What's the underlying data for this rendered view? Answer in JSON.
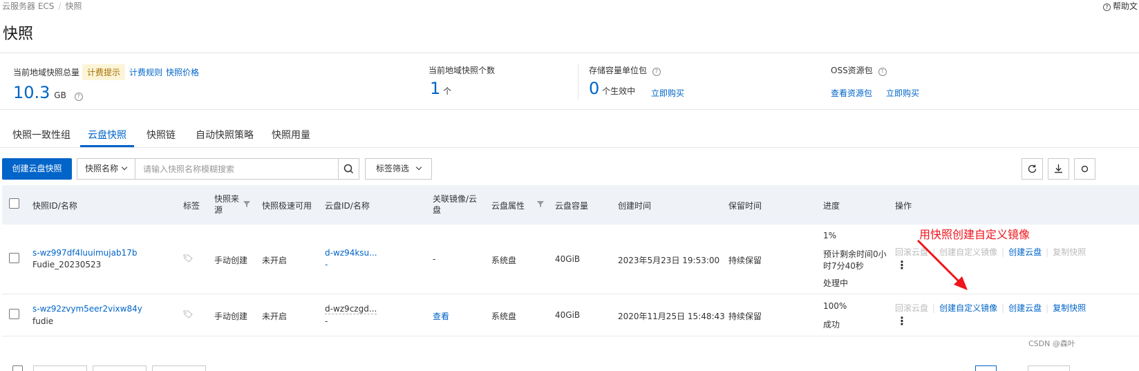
{
  "breadcrumb": {
    "root": "云服务器 ECS",
    "current": "快照"
  },
  "help": {
    "label": "帮助文"
  },
  "page": {
    "title": "快照"
  },
  "summary": {
    "total": {
      "label": "当前地域快照总量",
      "fee_tag": "计费提示",
      "rules_link": "计费规则",
      "price_link": "快照价格",
      "value": "10.3",
      "unit": "GB"
    },
    "count": {
      "label": "当前地域快照个数",
      "value": "1",
      "unit": "个"
    },
    "storage": {
      "label": "存储容量单位包",
      "value": "0",
      "unit": "个生效中",
      "buy_link": "立即购买"
    },
    "oss": {
      "label": "OSS资源包",
      "view_link": "查看资源包",
      "buy_link": "立即购买"
    }
  },
  "tabs": [
    {
      "label": "快照一致性组"
    },
    {
      "label": "云盘快照"
    },
    {
      "label": "快照链"
    },
    {
      "label": "自动快照策略"
    },
    {
      "label": "快照用量"
    }
  ],
  "toolbar": {
    "create_button": "创建云盘快照",
    "filter_select": "快照名称",
    "search_placeholder": "请输入快照名称模糊搜索",
    "tag_filter": "标签筛选"
  },
  "table": {
    "headers": {
      "id": "快照ID/名称",
      "tag": "标签",
      "source_line1": "快照来",
      "source_line2": "源",
      "fast": "快照极速可用",
      "disk": "云盘ID/名称",
      "image_line1": "关联镜像/云",
      "image_line2": "盘",
      "attr": "云盘属性",
      "size": "云盘容量",
      "created": "创建时间",
      "retention": "保留时间",
      "progress": "进度",
      "ops": "操作"
    },
    "rows": [
      {
        "id": "s-wz997df4luuimujab17b",
        "name": "Fudie_20230523",
        "source": "手动创建",
        "fast": "未开启",
        "disk_id": "d-wz94ksu...",
        "disk_name": "-",
        "image": "-",
        "attr": "系统盘",
        "size": "40GiB",
        "created": "2023年5月23日 19:53:00",
        "retention": "持续保留",
        "progress": "1%",
        "remaining_line1": "预计剩余时间0小",
        "remaining_line2": "时7分40秒",
        "status": "处理中",
        "ops": {
          "rollback": "回滚云盘",
          "create_image": "创建自定义镜像",
          "create_disk": "创建云盘",
          "copy": "复制快照"
        }
      },
      {
        "id": "s-wz92zvym5eer2vixw84y",
        "name": "fudie",
        "source": "手动创建",
        "fast": "未开启",
        "disk_id": "d-wz9czgd...",
        "disk_name": "-",
        "image": "查看",
        "attr": "系统盘",
        "size": "40GiB",
        "created": "2020年11月25日 15:48:43",
        "retention": "持续保留",
        "progress": "100%",
        "status": "成功",
        "ops": {
          "rollback": "回滚云盘",
          "create_image": "创建自定义镜像",
          "create_disk": "创建云盘",
          "copy": "复制快照"
        }
      }
    ]
  },
  "annotation": {
    "text": "用快照创建自定义镜像",
    "color": "#f0141b"
  },
  "watermark": "CSDN @森叶",
  "colors": {
    "primary": "#0064c8",
    "header_bg": "#eff3f8",
    "fee_tag_bg": "#fcf4d6"
  }
}
